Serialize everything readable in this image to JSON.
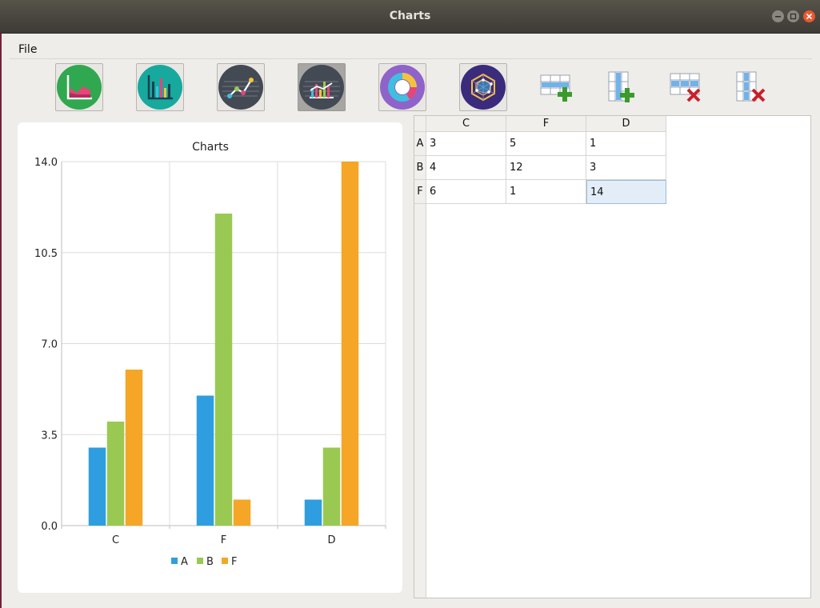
{
  "window": {
    "title": "Charts"
  },
  "menu": {
    "file_label": "File"
  },
  "toolbar": {
    "buttons": [
      {
        "name": "area-chart-button",
        "icon": "area-chart-icon"
      },
      {
        "name": "bar-chart-button",
        "icon": "bar-chart-icon"
      },
      {
        "name": "line-chart-button",
        "icon": "line-chart-icon"
      },
      {
        "name": "combo-chart-button",
        "icon": "combo-chart-icon",
        "active": true
      },
      {
        "name": "donut-chart-button",
        "icon": "donut-chart-icon"
      },
      {
        "name": "radar-chart-button",
        "icon": "radar-chart-icon"
      },
      {
        "name": "add-row-button",
        "icon": "add-row-icon"
      },
      {
        "name": "add-column-button",
        "icon": "add-column-icon"
      },
      {
        "name": "delete-row-button",
        "icon": "delete-row-icon"
      },
      {
        "name": "delete-column-button",
        "icon": "delete-column-icon"
      }
    ]
  },
  "colors": {
    "A": "#2f9ee0",
    "B": "#99c952",
    "F": "#f5a627"
  },
  "chart_data": {
    "type": "bar",
    "title": "Charts",
    "categories": [
      "C",
      "F",
      "D"
    ],
    "series": [
      {
        "name": "A",
        "values": [
          3,
          5,
          1
        ]
      },
      {
        "name": "B",
        "values": [
          4,
          12,
          3
        ]
      },
      {
        "name": "F",
        "values": [
          6,
          1,
          14
        ]
      }
    ],
    "ylim": [
      0,
      14
    ],
    "yticks": [
      "0.0",
      "3.5",
      "7.0",
      "10.5",
      "14.0"
    ],
    "grid": true,
    "legend": "bottom"
  },
  "table": {
    "columns": [
      "C",
      "F",
      "D"
    ],
    "rows": [
      {
        "header": "A",
        "cells": [
          "3",
          "5",
          "1"
        ]
      },
      {
        "header": "B",
        "cells": [
          "4",
          "12",
          "3"
        ]
      },
      {
        "header": "F",
        "cells": [
          "6",
          "1",
          "14"
        ]
      }
    ]
  }
}
